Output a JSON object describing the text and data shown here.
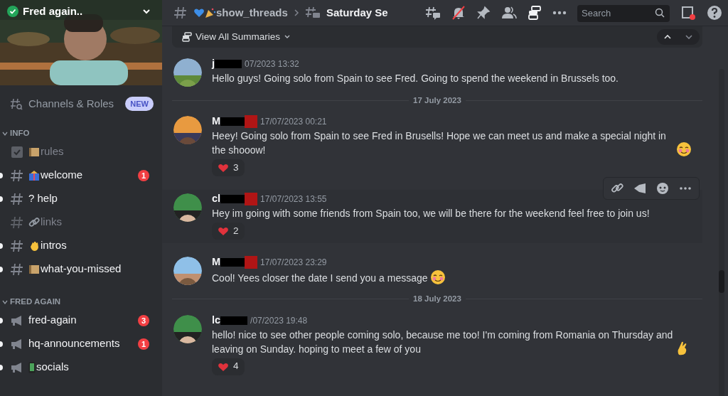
{
  "server": {
    "name": "Fred again..",
    "verified": true
  },
  "sidebar": {
    "browse": {
      "label": "Channels & Roles",
      "badge": "NEW"
    },
    "categories": [
      {
        "name": "INFO",
        "expanded": true,
        "channels": [
          {
            "kind": "rules",
            "emoji": {
              "kind": "scroll"
            },
            "name": "rules",
            "unread": false
          },
          {
            "kind": "text",
            "emoji": {
              "kind": "gift"
            },
            "name": "welcome",
            "unread": true,
            "badge": "1"
          },
          {
            "kind": "text",
            "name": "? help",
            "unread": true
          },
          {
            "kind": "text",
            "emoji": {
              "kind": "link"
            },
            "name": "links",
            "unread": false
          },
          {
            "kind": "text",
            "emoji": {
              "kind": "wave"
            },
            "name": "intros",
            "unread": true
          },
          {
            "kind": "text",
            "emoji": {
              "kind": "scroll"
            },
            "name": "what-you-missed",
            "unread": true
          }
        ]
      },
      {
        "name": "FRED AGAIN",
        "expanded": true,
        "channels": [
          {
            "kind": "announcement",
            "name": "fred-again",
            "unread": true,
            "badge": "3"
          },
          {
            "kind": "announcement",
            "name": "hq-announcements",
            "unread": true,
            "badge": "1"
          },
          {
            "kind": "announcement",
            "emoji": {
              "kind": "phone"
            },
            "name": "socials",
            "unread": true
          }
        ]
      }
    ]
  },
  "header": {
    "parent": "show_threads",
    "parent_emojis": [
      {
        "kind": "heart"
      },
      {
        "kind": "party"
      }
    ],
    "thread": "Saturday Se",
    "muted": true,
    "summaries_active": true,
    "search": {
      "placeholder": "Search"
    },
    "inbox_unread": true
  },
  "summary_bar": {
    "label": "View All Summaries"
  },
  "feed": [
    {
      "kind": "message",
      "author": "j",
      "redacted": true,
      "role_icon": false,
      "timestamp": "07/2023 13:32",
      "text": "Hello guys! Going solo from Spain to see Fred. Going to spend the weekend in Brussels too.",
      "hovered": false
    },
    {
      "kind": "divider",
      "label": "17 July 2023"
    },
    {
      "kind": "message",
      "author": "M",
      "redacted": true,
      "role_icon": true,
      "timestamp": "17/07/2023 00:21",
      "text": "Heey! Going solo from Spain to see Fred in Brusells! Hope we can meet us and make a special night in the shooow!",
      "emoji": {
        "kind": "blush"
      },
      "reactions": [
        {
          "count": "3"
        }
      ],
      "hovered": false
    },
    {
      "kind": "message",
      "author": "cl",
      "redacted": true,
      "role_icon": true,
      "timestamp": "17/07/2023 13:55",
      "text": "Hey im going with some friends from Spain too, we will be there for the weekend feel free to join us!",
      "reactions": [
        {
          "count": "2"
        }
      ],
      "hovered": true
    },
    {
      "kind": "message",
      "author": "M",
      "redacted": true,
      "role_icon": true,
      "timestamp": "17/07/2023 23:29",
      "text": "Cool! Yees closer the date I send you a message",
      "emoji": {
        "kind": "blush"
      },
      "hovered": false
    },
    {
      "kind": "divider",
      "label": "18 July 2023"
    },
    {
      "kind": "message",
      "author": "lc",
      "redacted": true,
      "role_icon": false,
      "timestamp": "/07/2023 19:48",
      "text": "hello! nice to see other people coming solo, because me too! I'm coming from Romania on Thursday and leaving on Sunday. hoping to meet a few of you",
      "emoji": {
        "kind": "fingers"
      },
      "reactions": [
        {
          "count": "4"
        }
      ],
      "hovered": false
    }
  ]
}
